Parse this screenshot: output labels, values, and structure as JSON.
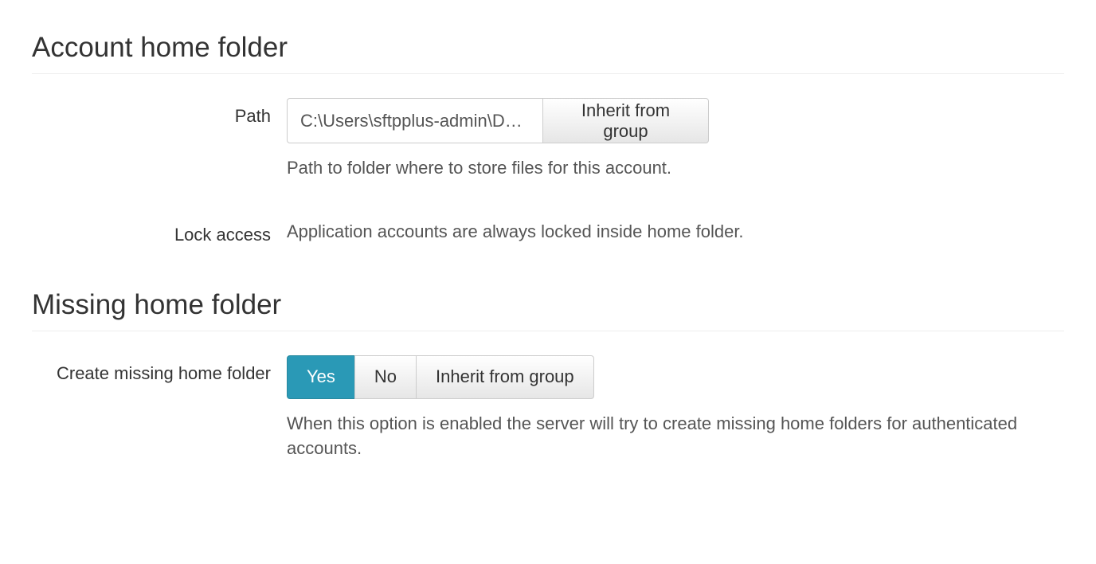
{
  "sections": {
    "account_home": {
      "title": "Account home folder",
      "fields": {
        "path": {
          "label": "Path",
          "value": "C:\\Users\\sftpplus-admin\\Documents",
          "button": "Inherit from group",
          "help": "Path to folder where to store files for this account."
        },
        "lock_access": {
          "label": "Lock access",
          "text": "Application accounts are always locked inside home folder."
        }
      }
    },
    "missing_home": {
      "title": "Missing home folder",
      "fields": {
        "create": {
          "label": "Create missing home folder",
          "options": {
            "yes": "Yes",
            "no": "No",
            "inherit": "Inherit from group"
          },
          "selected": "yes",
          "help": "When this option is enabled the server will try to create missing home folders for authenticated accounts."
        }
      }
    }
  }
}
